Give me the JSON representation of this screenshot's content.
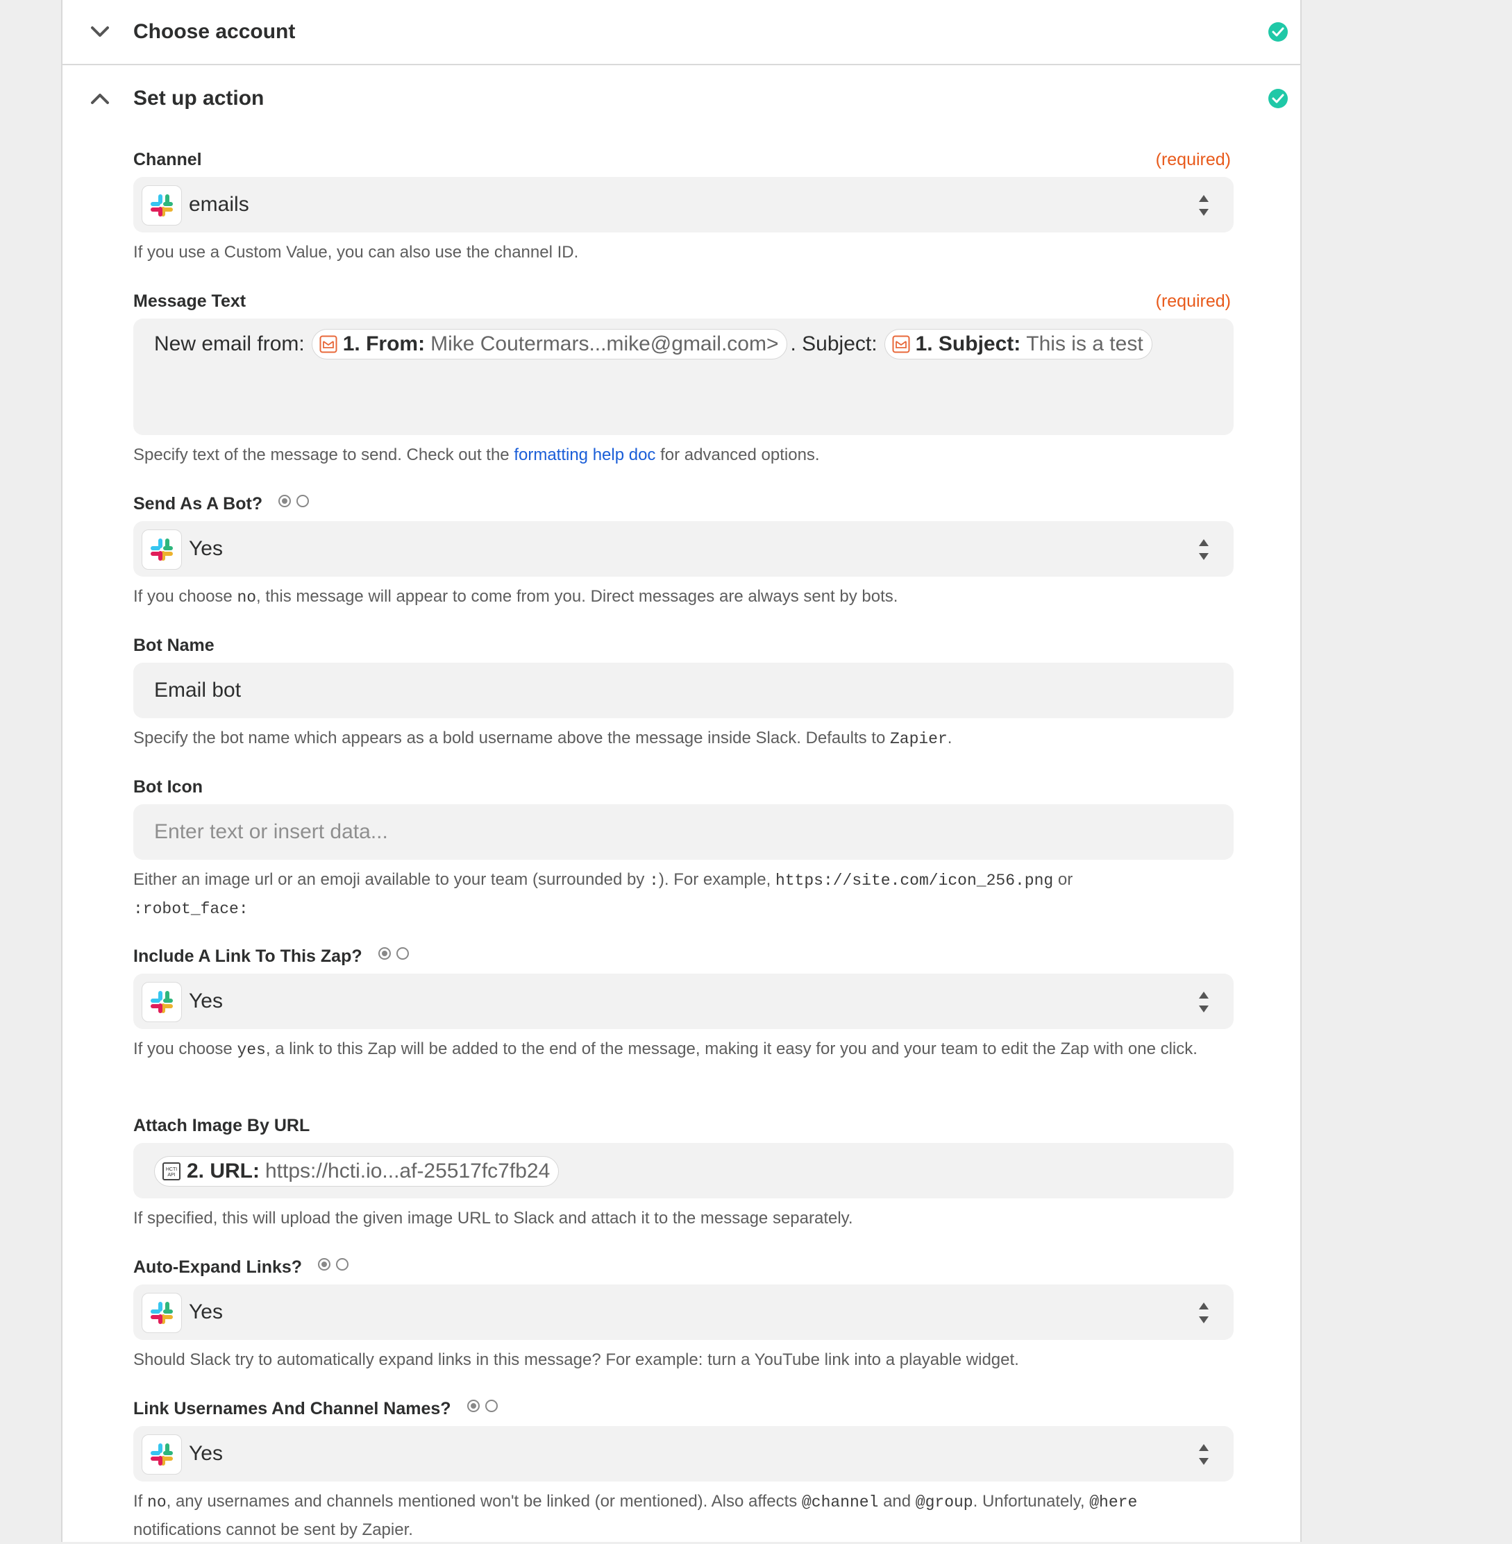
{
  "steps": {
    "choose_account": "Choose account",
    "set_up_action": "Set up action"
  },
  "colors": {
    "check": "#1fc8a7",
    "required": "#e85a1b",
    "link": "#1a5ed8"
  },
  "channel": {
    "label": "Channel",
    "required": "(required)",
    "value": "emails",
    "help": "If you use a Custom Value, you can also use the channel ID."
  },
  "message_text": {
    "label": "Message Text",
    "required": "(required)",
    "prefix": "New email from:",
    "pill1_key": "1. From:",
    "pill1_val": "Mike Coutermars...mike@gmail.com>",
    "middle": ". Subject:",
    "pill2_key": "1. Subject:",
    "pill2_val": "This is a test",
    "help_before": "Specify text of the message to send. Check out the",
    "help_link": "formatting help doc",
    "help_after": "for advanced options."
  },
  "send_as_bot": {
    "label": "Send As A Bot?",
    "value": "Yes",
    "help_before": "If you choose",
    "help_code": "no",
    "help_after": ", this message will appear to come from you. Direct messages are always sent by bots."
  },
  "bot_name": {
    "label": "Bot Name",
    "value": "Email bot",
    "help_before": "Specify the bot name which appears as a bold username above the message inside Slack. Defaults to",
    "help_code": "Zapier",
    "help_after": "."
  },
  "bot_icon": {
    "label": "Bot Icon",
    "placeholder": "Enter text or insert data...",
    "help_before": "Either an image url or an emoji available to your team (surrounded by",
    "help_code1": ":",
    "help_mid": "). For example,",
    "help_code2": "https://site.com/icon_256.png",
    "help_or": "or",
    "help_code3": ":robot_face:"
  },
  "include_link": {
    "label": "Include A Link To This Zap?",
    "value": "Yes",
    "help_before": "If you choose",
    "help_code": "yes",
    "help_after": ", a link to this Zap will be added to the end of the message, making it easy for you and your team to edit the Zap with one click."
  },
  "attach_image": {
    "label": "Attach Image By URL",
    "pill_key": "2. URL:",
    "pill_val": "https://hcti.io...af-25517fc7fb24",
    "help": "If specified, this will upload the given image URL to Slack and attach it to the message separately."
  },
  "auto_expand": {
    "label": "Auto-Expand Links?",
    "value": "Yes",
    "help": "Should Slack try to automatically expand links in this message? For example: turn a YouTube link into a playable widget."
  },
  "link_usernames": {
    "label": "Link Usernames And Channel Names?",
    "value": "Yes",
    "help_before": "If",
    "help_code1": "no",
    "help_mid1": ", any usernames and channels mentioned won't be linked (or mentioned). Also affects",
    "help_code2": "@channel",
    "help_and": "and",
    "help_code3": "@group",
    "help_mid2": ". Unfortunately,",
    "help_code4": "@here",
    "help_after": "notifications cannot be sent by Zapier."
  },
  "icons": {
    "chevron_down": "chevron-down-icon",
    "chevron_up": "chevron-up-icon",
    "check": "check-circle-icon",
    "slack": "slack-icon",
    "email": "email-icon",
    "hcti": "hcti-api-icon",
    "updown": "sort-arrows-icon"
  }
}
